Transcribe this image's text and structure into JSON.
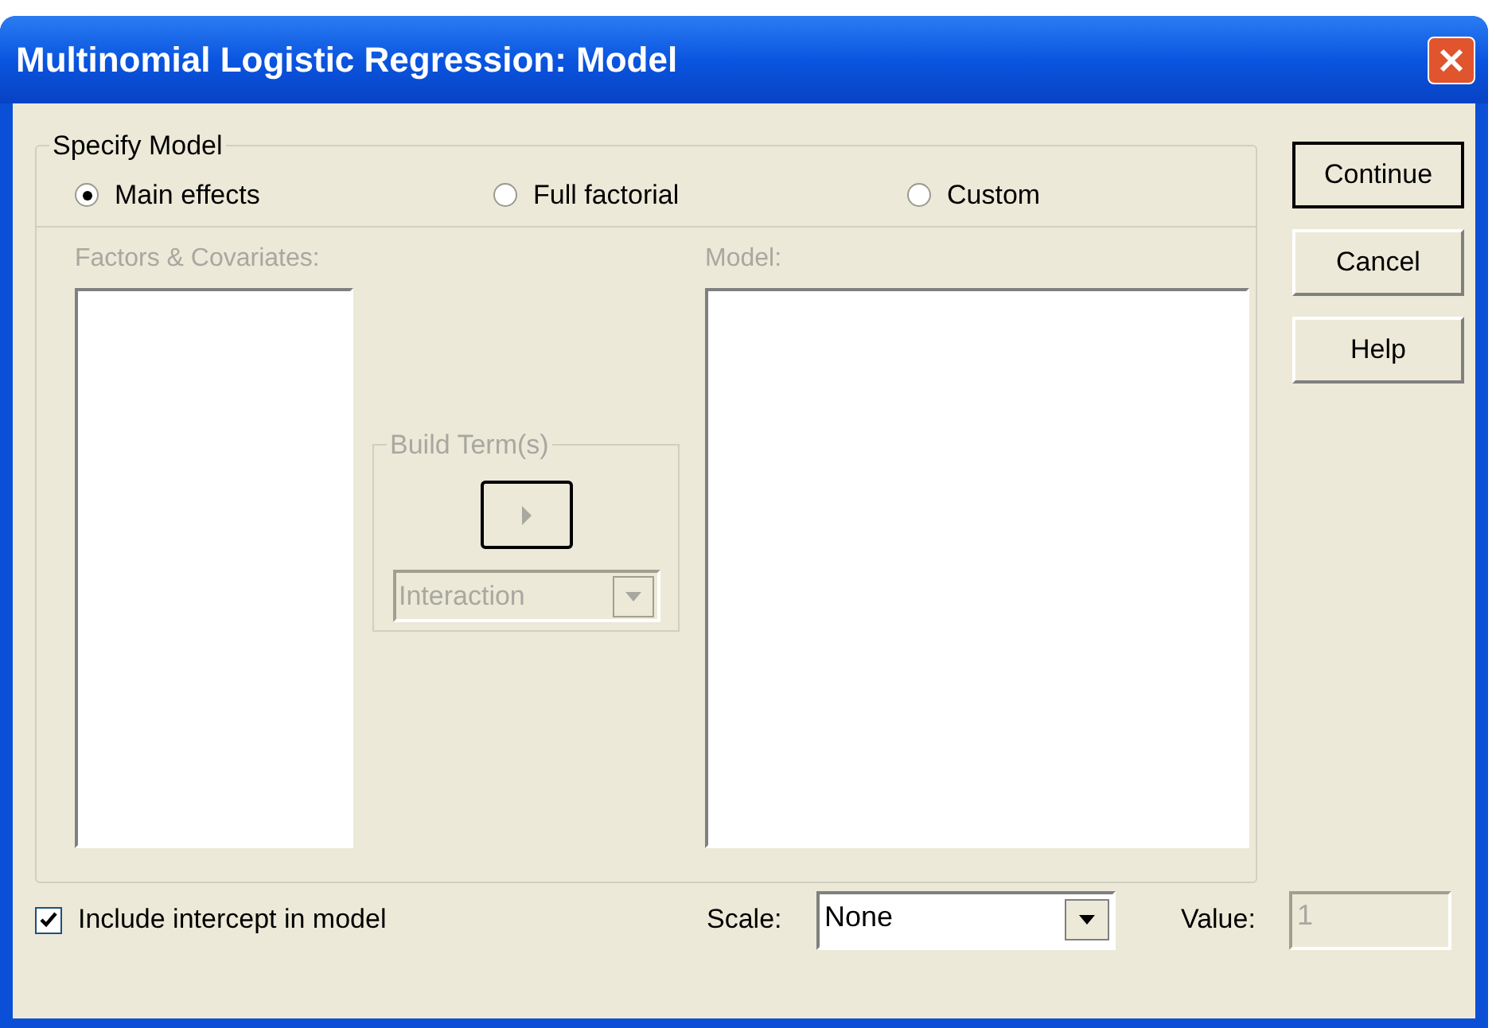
{
  "window": {
    "title": "Multinomial Logistic Regression: Model"
  },
  "specify_model": {
    "label": "Specify Model",
    "options": [
      {
        "label": "Main effects",
        "selected": true
      },
      {
        "label": "Full factorial",
        "selected": false
      },
      {
        "label": "Custom",
        "selected": false
      }
    ]
  },
  "factors_covariates": {
    "label": "Factors & Covariates:",
    "disabled": true
  },
  "model": {
    "label": "Model:",
    "disabled": true
  },
  "build_terms": {
    "label": "Build Term(s)",
    "disabled": true,
    "type": "Interaction"
  },
  "buttons": [
    {
      "label": "Continue",
      "default": true
    },
    {
      "label": "Cancel",
      "default": false
    },
    {
      "label": "Help",
      "default": false
    }
  ],
  "include_intercept": {
    "label": "Include intercept in model",
    "checked": true
  },
  "scale": {
    "label": "Scale:",
    "value": "None"
  },
  "value": {
    "label": "Value:",
    "value": "1",
    "disabled": true
  }
}
